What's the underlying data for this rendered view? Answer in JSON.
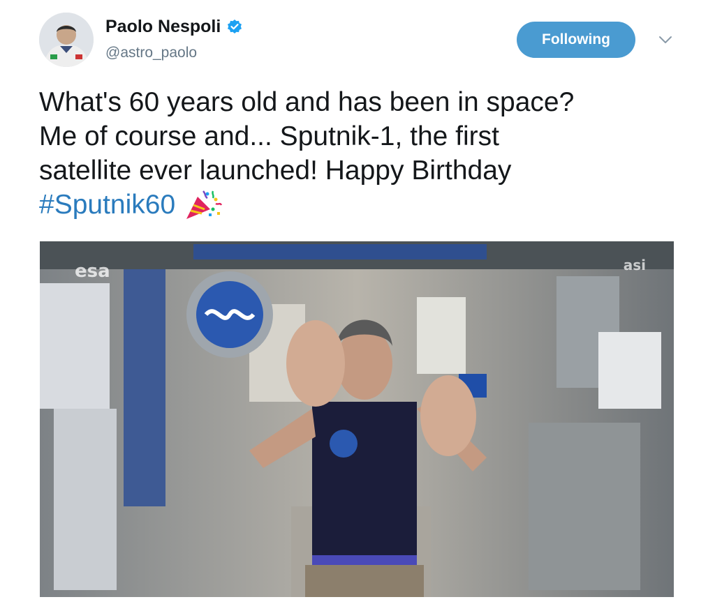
{
  "user": {
    "display_name": "Paolo Nespoli",
    "handle": "@astro_paolo",
    "verified": true,
    "avatar_icon": "astronaut-avatar"
  },
  "actions": {
    "follow_label": "Following",
    "menu_icon": "chevron-down-icon"
  },
  "tweet": {
    "lines": [
      "What's 60 years old and has been in space?",
      "Me of course and... Sputnik-1, the first",
      "satellite ever launched! Happy Birthday"
    ],
    "hashtag": "#Sputnik60",
    "emoji_icon": "party-popper-icon"
  },
  "media": {
    "watermark_left": "esa",
    "watermark_right": "asi"
  },
  "colors": {
    "follow_button": "#4a9bd1",
    "hashtag": "#2a7bbd",
    "handle": "#657786",
    "text": "#14171a"
  }
}
